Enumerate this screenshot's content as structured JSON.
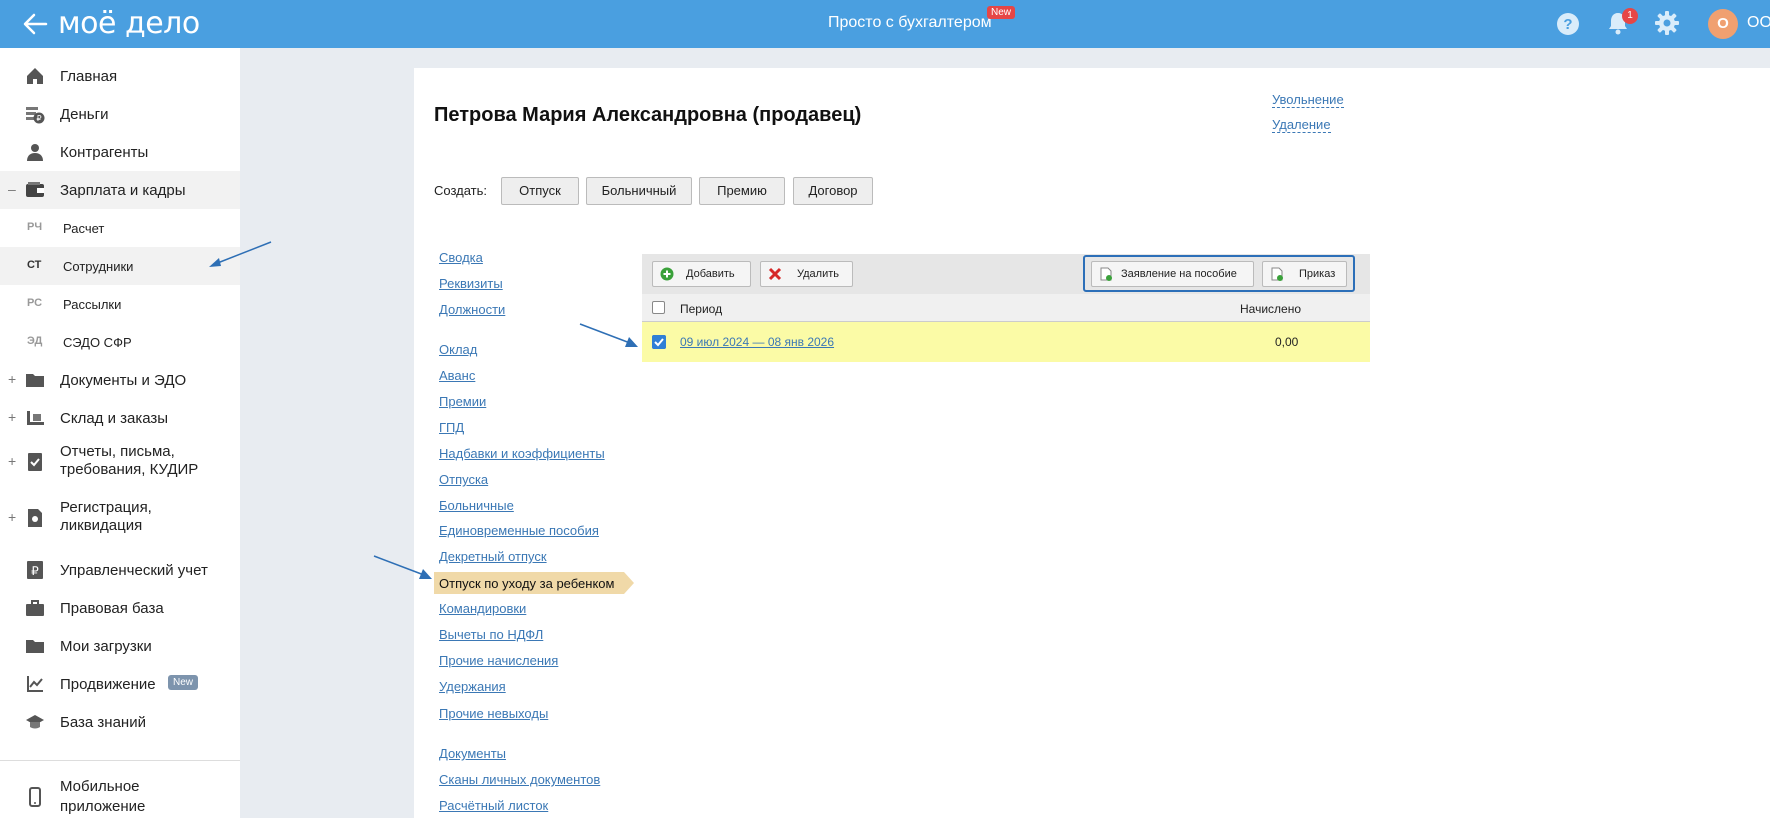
{
  "header": {
    "logo": "моё дело",
    "center_title": "Просто с бухгалтером",
    "new_badge": "New",
    "notifications_count": "1",
    "avatar_letter": "О",
    "org_name": "ООО"
  },
  "sidebar": {
    "items": [
      {
        "label": "Главная",
        "icon": "home-icon"
      },
      {
        "label": "Деньги",
        "icon": "money-icon"
      },
      {
        "label": "Контрагенты",
        "icon": "contractors-icon"
      },
      {
        "label": "Зарплата и кадры",
        "icon": "wallet-icon",
        "toggle": "–"
      }
    ],
    "subitems": [
      {
        "abbr": "РЧ",
        "label": "Расчет"
      },
      {
        "abbr": "СТ",
        "label": "Сотрудники"
      },
      {
        "abbr": "РС",
        "label": "Рассылки"
      },
      {
        "abbr": "ЭД",
        "label": "СЭДО СФР"
      }
    ],
    "items2": [
      {
        "label": "Документы и ЭДО",
        "icon": "folder-icon",
        "toggle": "+"
      },
      {
        "label": "Склад и заказы",
        "icon": "warehouse-icon",
        "toggle": "+"
      },
      {
        "label": "Отчеты, письма,",
        "label2": "требования, КУДИР",
        "icon": "report-icon",
        "toggle": "+"
      },
      {
        "label": "Регистрация,",
        "label2": "ликвидация",
        "icon": "registration-icon",
        "toggle": "+"
      },
      {
        "label": "Управленческий учет",
        "icon": "ruble-icon"
      },
      {
        "label": "Правовая база",
        "icon": "briefcase-icon"
      },
      {
        "label": "Мои загрузки",
        "icon": "folder-icon"
      },
      {
        "label": "Продвижение",
        "icon": "chart-icon",
        "badge": "New"
      },
      {
        "label": "База знаний",
        "icon": "graduation-icon"
      }
    ],
    "mobile": {
      "label": "Мобильное",
      "label2": "приложение"
    }
  },
  "main": {
    "person_title": "Петрова Мария Александровна (продавец)",
    "dismiss_link": "Увольнение",
    "delete_link": "Удаление",
    "create_label": "Создать:",
    "create_buttons": [
      "Отпуск",
      "Больничный",
      "Премию",
      "Договор"
    ],
    "left_links_1": [
      "Сводка",
      "Реквизиты",
      "Должности"
    ],
    "left_links_2": [
      "Оклад",
      "Аванс",
      "Премии",
      "ГПД",
      "Надбавки и коэффициенты",
      "Отпуска",
      "Больничные",
      "Единовременные пособия",
      "Декретный отпуск"
    ],
    "active_link": "Отпуск по уходу за ребенком",
    "left_links_3": [
      "Командировки",
      "Вычеты по НДФЛ",
      "Прочие начисления",
      "Удержания",
      "Прочие невыходы"
    ],
    "left_links_4": [
      "Документы",
      "Сканы личных документов",
      "Расчётный листок"
    ],
    "toolbar": {
      "add": "Добавить",
      "delete": "Удалить",
      "application": "Заявление на пособие",
      "order": "Приказ"
    },
    "table": {
      "col_period": "Период",
      "col_accrued": "Начислено",
      "rows": [
        {
          "period": "09 июл 2024 — 08 янв 2026",
          "accrued": "0,00",
          "checked": true
        }
      ]
    }
  }
}
